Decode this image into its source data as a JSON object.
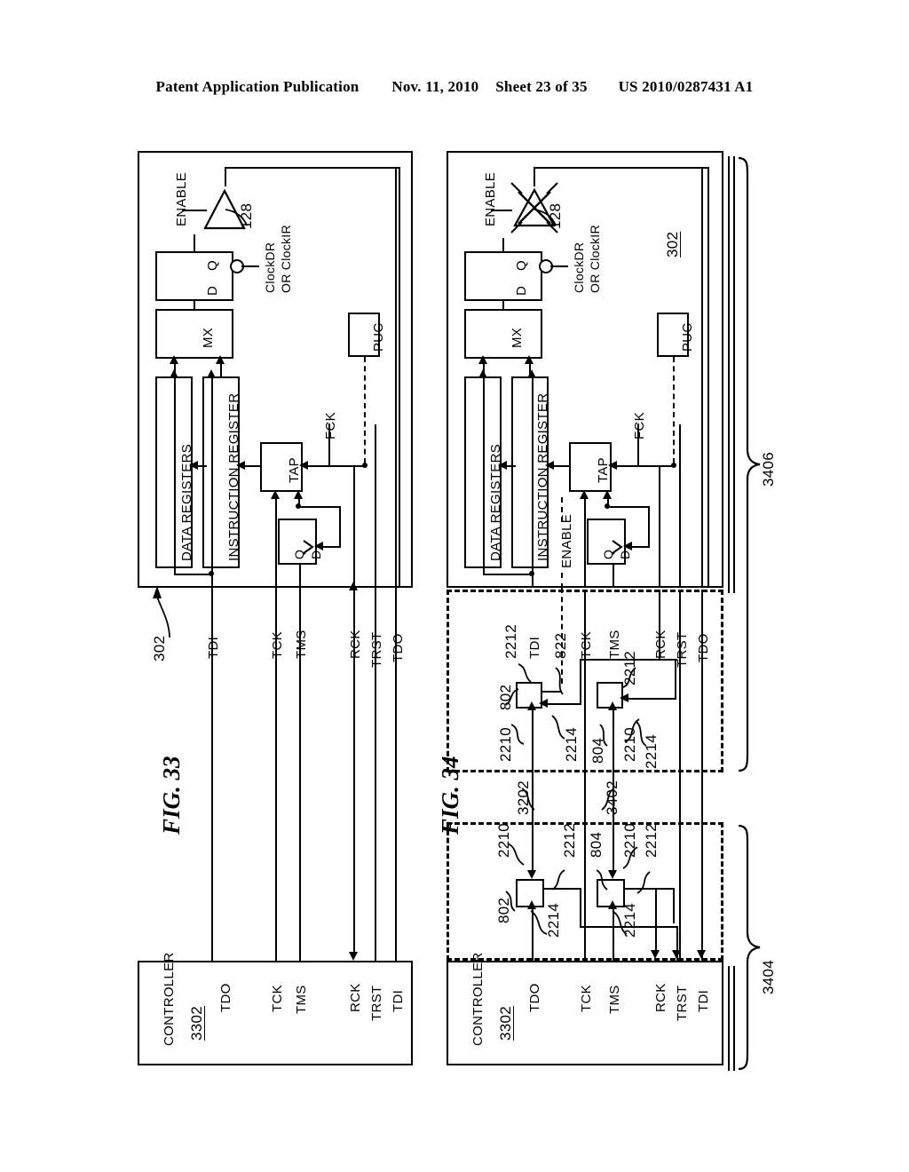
{
  "header": {
    "publication": "Patent Application Publication",
    "date": "Nov. 11, 2010",
    "sheet": "Sheet 23 of 35",
    "patent_number": "US 2010/0287431 A1"
  },
  "figures": [
    {
      "caption": "FIG. 33",
      "chip": {
        "ref": "302",
        "blocks": {
          "data_registers": "DATA REGISTERS",
          "instruction_register": "INSTRUCTION REGISTER",
          "mx": "MX",
          "tap": "TAP",
          "puc": "PUC",
          "flop_d": "D",
          "flop_q": "Q",
          "dq_d": "D",
          "dq_q": "Q"
        },
        "labels": {
          "enable": "ENABLE",
          "buffer_ref": "128",
          "clock": "ClockDR\nOR ClockIR",
          "clock_line1": "ClockDR",
          "clock_line2": "OR ClockIR",
          "fck": "FCK"
        },
        "pins": [
          "TDI",
          "TCK",
          "TMS",
          "RCK",
          "TRST",
          "TDO"
        ]
      },
      "controller": {
        "title": "CONTROLLER",
        "ref": "3302",
        "pins": [
          "TDO",
          "TCK",
          "TMS",
          "RCK",
          "TRST",
          "TDI"
        ]
      }
    },
    {
      "caption": "FIG. 34",
      "chip": {
        "ref": "302",
        "blocks": {
          "data_registers": "DATA REGISTERS",
          "instruction_register": "INSTRUCTION REGISTER",
          "mx": "MX",
          "tap": "TAP",
          "puc": "PUC",
          "flop_d": "D",
          "flop_q": "Q",
          "dq_d": "D",
          "dq_q": "Q"
        },
        "labels": {
          "enable": "ENABLE",
          "enable_internal": "ENABLE",
          "buffer_ref": "128",
          "clock_line1": "ClockDR",
          "clock_line2": "OR ClockIR",
          "fck": "FCK"
        },
        "pins": [
          "TDI",
          "TCK",
          "TMS",
          "RCK",
          "TRST",
          "TDO"
        ],
        "buffer_disabled": true
      },
      "upper_group": {
        "bracket_ref": "3406",
        "signal_822": "822",
        "blocks": [
          {
            "ref": "802",
            "in_ref": "2210",
            "out_ref": "2212",
            "side_ref": "2214"
          },
          {
            "ref": "804",
            "in_ref": "2210",
            "out_ref": "2212",
            "side_ref": "2214"
          }
        ]
      },
      "lower_group": {
        "bracket_ref": "3404",
        "bus_refs": [
          "3202",
          "3402"
        ],
        "blocks": [
          {
            "ref": "802",
            "in_ref": "2210",
            "out_ref": "2212",
            "side_ref": "2214"
          },
          {
            "ref": "804",
            "in_ref": "2210",
            "out_ref": "2212",
            "side_ref": "2214"
          }
        ]
      },
      "controller": {
        "title": "CONTROLLER",
        "ref": "3302",
        "pins": [
          "TDO",
          "TCK",
          "TMS",
          "RCK",
          "TRST",
          "TDI"
        ]
      }
    }
  ]
}
